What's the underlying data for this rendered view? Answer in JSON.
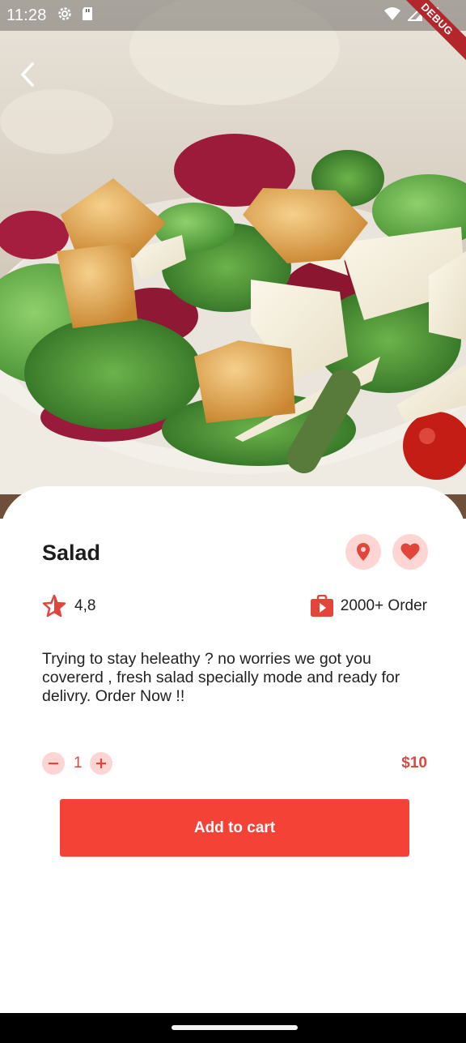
{
  "status_bar": {
    "time": "11:28",
    "left_icons": [
      "settings-icon",
      "sd-card-icon"
    ],
    "right_icons": [
      "wifi-icon",
      "signal-icon",
      "battery-icon"
    ]
  },
  "debug_banner": "DEBUG",
  "nav": {
    "back_icon": "chevron-left-icon"
  },
  "product": {
    "name": "Salad",
    "rating": "4,8",
    "orders": "2000+ Order",
    "description": "Trying to stay heleathy ? no worries we got you covererd , fresh salad specially mode and ready for delivry. Order Now !!",
    "quantity": "1",
    "price": "$10"
  },
  "actions": {
    "location_icon": "location-pin-icon",
    "favorite_icon": "heart-icon",
    "add_to_cart": "Add to cart"
  },
  "colors": {
    "accent": "#f44336",
    "accent_text": "#e3453b",
    "icon_bg": "#fdd6d3",
    "text": "#1d1d1d"
  }
}
